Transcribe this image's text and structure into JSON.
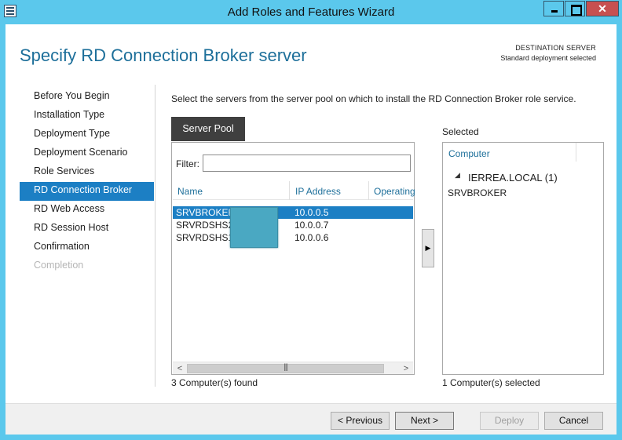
{
  "window": {
    "title": "Add Roles and Features Wizard"
  },
  "header": {
    "page_title": "Specify RD Connection Broker server",
    "destination_label": "DESTINATION SERVER",
    "destination_value": "Standard deployment selected"
  },
  "nav": {
    "items": [
      {
        "label": "Before You Begin",
        "state": "normal"
      },
      {
        "label": "Installation Type",
        "state": "normal"
      },
      {
        "label": "Deployment Type",
        "state": "normal"
      },
      {
        "label": "Deployment Scenario",
        "state": "normal"
      },
      {
        "label": "Role Services",
        "state": "normal"
      },
      {
        "label": "RD Connection Broker",
        "state": "active"
      },
      {
        "label": "RD Web Access",
        "state": "normal"
      },
      {
        "label": "RD Session Host",
        "state": "normal"
      },
      {
        "label": "Confirmation",
        "state": "normal"
      },
      {
        "label": "Completion",
        "state": "disabled"
      }
    ]
  },
  "main": {
    "instruction": "Select the servers from the server pool on which to install the RD Connection Broker role service.",
    "pool": {
      "tab_label": "Server Pool",
      "filter_label": "Filter:",
      "filter_value": "",
      "columns": [
        "Name",
        "IP Address",
        "Operating"
      ],
      "rows": [
        {
          "name": "SRVBROKER.",
          "ip": "10.0.0.5",
          "selected": true
        },
        {
          "name": "SRVRDSHS2.",
          "ip": "10.0.0.7",
          "selected": false
        },
        {
          "name": "SRVRDSHS1.",
          "ip": "10.0.0.6",
          "selected": false
        }
      ],
      "found_text": "3 Computer(s) found"
    },
    "add_button_icon": "arrow-right-icon",
    "selected": {
      "label": "Selected",
      "column": "Computer",
      "group_label": "IERREA.LOCAL (1)",
      "items": [
        "SRVBROKER"
      ],
      "count_text": "1 Computer(s) selected"
    }
  },
  "footer": {
    "previous": "< Previous",
    "next": "Next >",
    "deploy": "Deploy",
    "cancel": "Cancel"
  },
  "colors": {
    "titlebar": "#5bc8ec",
    "accent": "#1c7fc4",
    "heading": "#1d6f9a",
    "close_button": "#c75050"
  }
}
